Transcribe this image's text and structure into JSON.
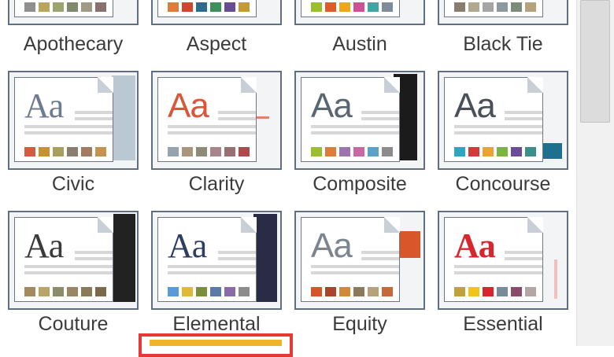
{
  "gallery": {
    "themes": [
      {
        "name": "Apothecary",
        "aa": "",
        "aa_color": "#55606e",
        "swatches": [
          "#8f8f8f",
          "#b9a55e",
          "#9aa66b",
          "#7f8a6f",
          "#a09a84",
          "#8b6f6f"
        ]
      },
      {
        "name": "Aspect",
        "aa": "",
        "aa_color": "#d05a2b",
        "swatches": [
          "#e07b39",
          "#d4452c",
          "#2d6a8f",
          "#3d8f5c",
          "#6a4c93",
          "#c49a35"
        ]
      },
      {
        "name": "Austin",
        "aa": "",
        "aa_color": "#6a8f2b",
        "swatches": [
          "#9bbf2a",
          "#e05a2a",
          "#f2a71b",
          "#d14f95",
          "#3fa6a6",
          "#7e8c99"
        ]
      },
      {
        "name": "Black Tie",
        "aa": "",
        "aa_color": "#333333",
        "swatches": [
          "#8a7d6e",
          "#b2a88e",
          "#a5a5a5",
          "#8c9aa0",
          "#7c8a78",
          "#b5a17a"
        ]
      },
      {
        "name": "Civic",
        "aa": "Aa",
        "aa_color": "#6c7a92",
        "swatches": [
          "#d65a3c",
          "#c8932f",
          "#a7a05d",
          "#8a7f6e",
          "#a57a63",
          "#c6924f"
        ]
      },
      {
        "name": "Clarity",
        "aa": "Aa",
        "aa_color": "#d8563a",
        "swatches": [
          "#94a3ad",
          "#a9967a",
          "#8e8a78",
          "#a8858a",
          "#9a6f6f",
          "#b3474b"
        ]
      },
      {
        "name": "Composite",
        "aa": "Aa",
        "aa_color": "#5b6672",
        "swatches": [
          "#9bbf2a",
          "#e07b39",
          "#9d74b0",
          "#c86aa2",
          "#5aa3c8",
          "#8c8c8c"
        ]
      },
      {
        "name": "Concourse",
        "aa": "Aa",
        "aa_color": "#4a5058",
        "swatches": [
          "#2ba7c4",
          "#d43a3a",
          "#f0a22e",
          "#7ab53d",
          "#6b4c9a",
          "#3a8f8a"
        ]
      },
      {
        "name": "Couture",
        "aa": "Aa",
        "aa_color": "#3a3a3a",
        "swatches": [
          "#a58a5f",
          "#b7a46a",
          "#8c8c6a",
          "#9a8566",
          "#8a7a5a",
          "#7a6a4a"
        ]
      },
      {
        "name": "Elemental",
        "aa": "Aa",
        "aa_color": "#2e3e62",
        "swatches": [
          "#5a9ad8",
          "#e0b83a",
          "#7a8f3a",
          "#5a7aa8",
          "#8a6aa8",
          "#8c8c8c"
        ]
      },
      {
        "name": "Equity",
        "aa": "Aa",
        "aa_color": "#7c8490",
        "swatches": [
          "#d6562a",
          "#a8452a",
          "#d08a3a",
          "#8a7a5a",
          "#b5a17a",
          "#c46a3a"
        ]
      },
      {
        "name": "Essential",
        "aa": "Aa",
        "aa_color": "#d9262e",
        "swatches": [
          "#c0a13a",
          "#f0c419",
          "#d9262e",
          "#7a8a9a",
          "#8a4a6a",
          "#b5a5a5"
        ]
      }
    ]
  },
  "colors": {
    "tile_border": "#5f6f80",
    "selection_border": "#e53935",
    "selection_fill": "#f0b429"
  }
}
